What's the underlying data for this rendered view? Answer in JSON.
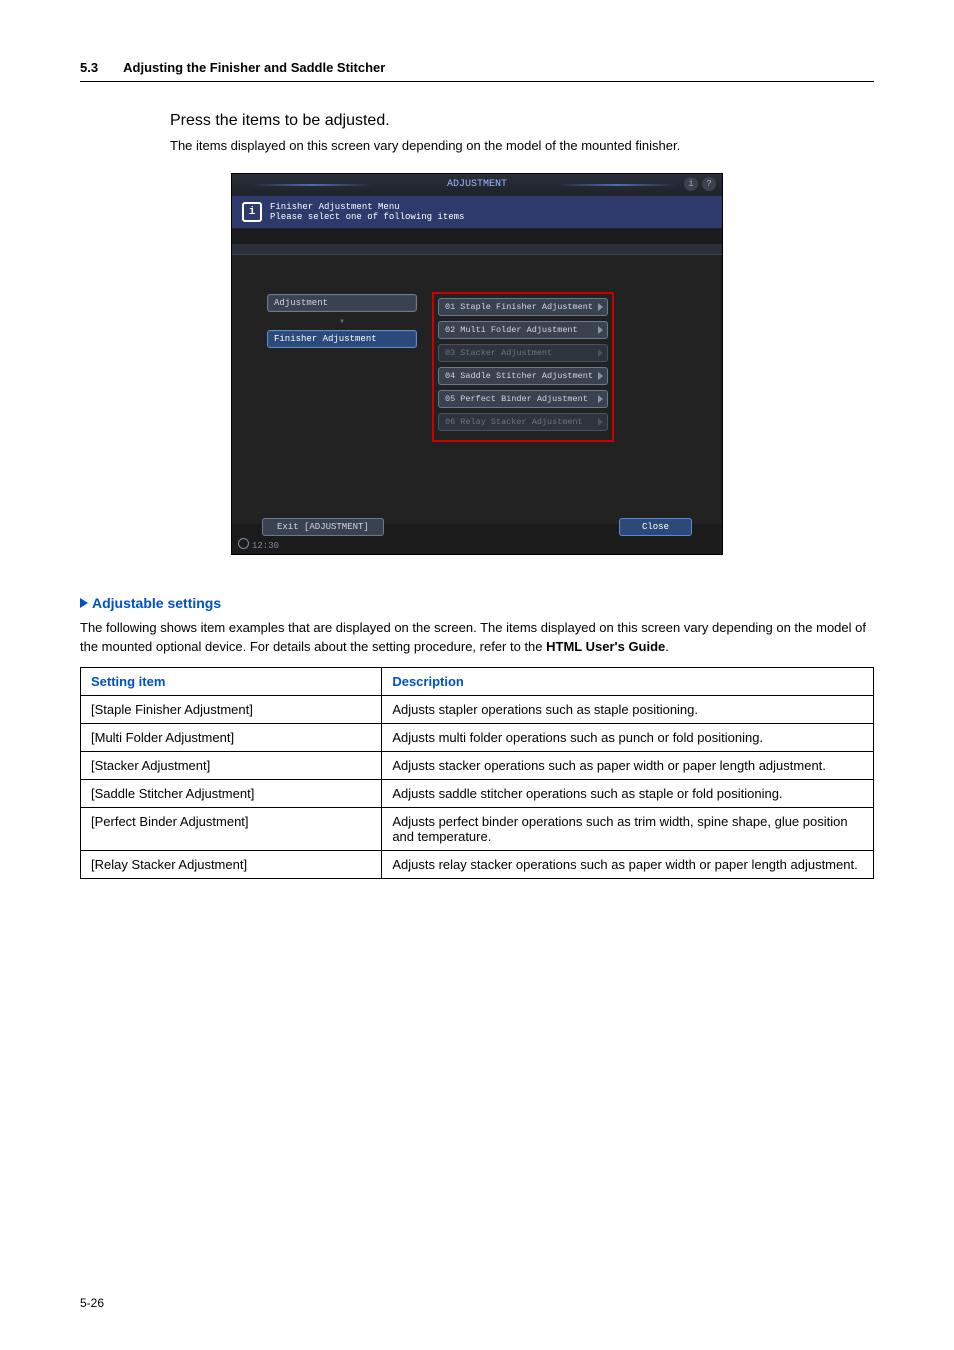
{
  "header": {
    "section_number": "5.3",
    "section_title": "Adjusting the Finisher and Saddle Stitcher"
  },
  "step_text": "Press the items to be adjusted.",
  "note_text": "The items displayed on this screen vary depending on the model of the mounted finisher.",
  "screenshot": {
    "title": "ADJUSTMENT",
    "info_line1": "Finisher Adjustment Menu",
    "info_line2": "Please select one of following items",
    "nav": {
      "item1": "Adjustment",
      "item2": "Finisher Adjustment"
    },
    "options": {
      "o1": "01 Staple Finisher Adjustment",
      "o2": "02 Multi Folder Adjustment",
      "o3": "03 Stacker Adjustment",
      "o4": "04 Saddle Stitcher Adjustment",
      "o5": "05 Perfect Binder Adjustment",
      "o6": "06 Relay Stacker Adjustment"
    },
    "footer": {
      "exit": "Exit [ADJUSTMENT]",
      "close": "Close"
    },
    "clock": "12:30"
  },
  "subheading": "Adjustable settings",
  "paragraph_parts": {
    "p1": "The following shows item examples that are displayed on the screen. The items displayed on this screen vary depending on the model of the mounted optional device. For details about the setting procedure, refer to the ",
    "p2": "HTML User's Guide",
    "p3": "."
  },
  "table": {
    "head": {
      "c1": "Setting item",
      "c2": "Description"
    },
    "rows": [
      {
        "c1": "[Staple Finisher Adjustment]",
        "c2": "Adjusts stapler operations such as staple positioning."
      },
      {
        "c1": "[Multi Folder Adjustment]",
        "c2": "Adjusts multi folder operations such as punch or fold positioning."
      },
      {
        "c1": "[Stacker Adjustment]",
        "c2": "Adjusts stacker operations such as paper width or paper length adjustment."
      },
      {
        "c1": "[Saddle Stitcher Adjustment]",
        "c2": "Adjusts saddle stitcher operations such as staple or fold positioning."
      },
      {
        "c1": "[Perfect Binder Adjustment]",
        "c2": "Adjusts perfect binder operations such as trim width, spine shape, glue position and temperature."
      },
      {
        "c1": "[Relay Stacker Adjustment]",
        "c2": "Adjusts relay stacker operations such as paper width or paper length adjustment."
      }
    ]
  },
  "page_number": "5-26"
}
